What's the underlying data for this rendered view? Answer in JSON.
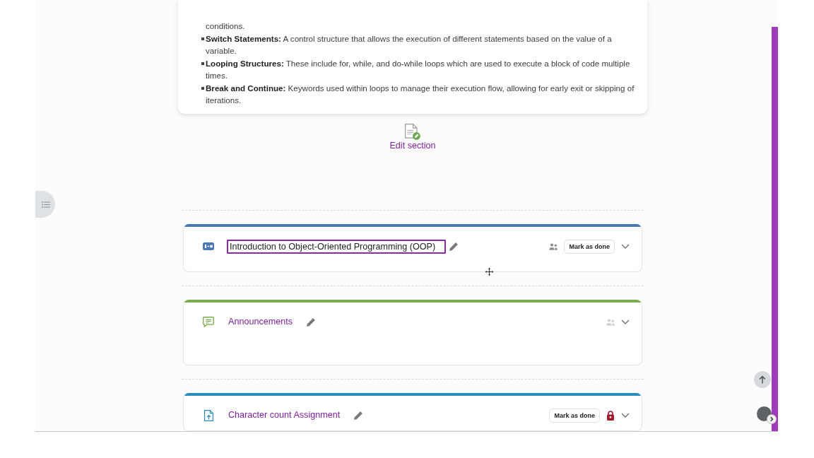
{
  "section_summary": {
    "items": [
      {
        "kind": "continuation",
        "text": "conditions."
      },
      {
        "kind": "bullet",
        "text": "**Switch Statements:** A control structure that allows the execution of different statements based on the value of a variable."
      },
      {
        "kind": "bullet",
        "text": "**Looping Structures:** These include for, while, and do-while loops which are used to execute a block of code multiple times."
      },
      {
        "kind": "bullet",
        "text": "**Break and Continue:** Keywords used within loops to manage their execution flow, allowing for early exit or skipping of iterations."
      }
    ]
  },
  "edit_section": {
    "label": "Edit section"
  },
  "activities": [
    {
      "kind": "h5p",
      "title": "Introduction to Object-Oriented Programming (OOP)",
      "editing": true,
      "color": "#4a78b5",
      "group_icon": {
        "dimmed": false
      },
      "mark_done": "Mark as done",
      "locked": false
    },
    {
      "kind": "forum",
      "title": "Announcements",
      "editing": false,
      "color": "#7aab4c",
      "group_icon": {
        "dimmed": true
      },
      "locked": false
    },
    {
      "kind": "assign",
      "title": "Character count Assignment",
      "editing": false,
      "color": "#2a8cbf",
      "mark_done": "Mark as done",
      "locked": true
    }
  ]
}
